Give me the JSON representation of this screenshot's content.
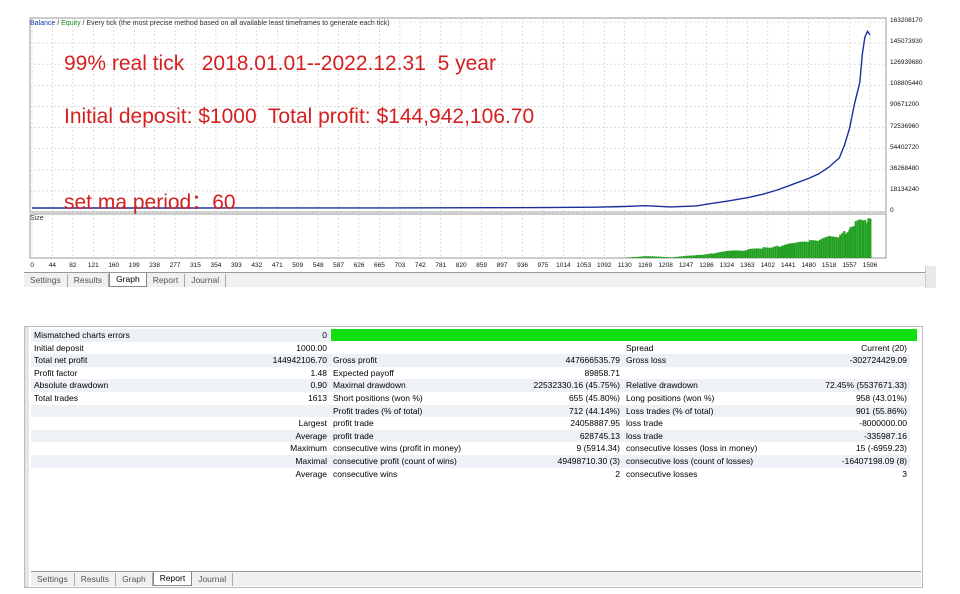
{
  "chart": {
    "legend": {
      "balance": "Balance",
      "separator1": " / ",
      "equity": "Equity",
      "rest": " / Every tick (the most precise method based on all available least timeframes to generate each tick)"
    },
    "overlay_lines": [
      "99% real tick   2018.01.01--2022.12.31  5 year",
      "Initial deposit: $1000  Total profit: $144,942,106.70",
      "set ma period：60"
    ],
    "size_label": "Size",
    "y_ticks": [
      "163208170",
      "145073930",
      "126939680",
      "108805440",
      "90671200",
      "72536960",
      "54402720",
      "36268480",
      "18134240",
      "0"
    ],
    "x_ticks": [
      "0",
      "44",
      "82",
      "121",
      "160",
      "199",
      "238",
      "277",
      "315",
      "354",
      "393",
      "432",
      "471",
      "509",
      "548",
      "587",
      "626",
      "665",
      "703",
      "742",
      "781",
      "820",
      "859",
      "897",
      "936",
      "975",
      "1014",
      "1053",
      "1092",
      "1130",
      "1169",
      "1208",
      "1247",
      "1286",
      "1324",
      "1363",
      "1402",
      "1441",
      "1480",
      "1518",
      "1557",
      "1596"
    ],
    "colors": {
      "balance": "#1a2f9a",
      "equity": "#2a9a2a",
      "grid": "#c8c8c8",
      "volume": "#22a022"
    }
  },
  "chart_data": {
    "type": "line",
    "x": [
      0,
      100,
      200,
      300,
      400,
      500,
      600,
      700,
      800,
      900,
      1000,
      1100,
      1150,
      1200,
      1250,
      1300,
      1330,
      1360,
      1400,
      1430,
      1460,
      1490,
      1520,
      1540,
      1560,
      1580,
      1590,
      1600,
      1610,
      1620,
      1625,
      1630,
      1635,
      1640
    ],
    "series": [
      {
        "name": "Balance",
        "values": [
          1000,
          2000,
          5000,
          9000,
          15000,
          25000,
          45000,
          90000,
          160000,
          250000,
          400000,
          700000,
          1200000,
          2000000,
          900000,
          1800000,
          4000000,
          6000000,
          9000000,
          12000000,
          16000000,
          21000000,
          26000000,
          30000000,
          36000000,
          44000000,
          55000000,
          70000000,
          92000000,
          110000000,
          135000000,
          150000000,
          155000000,
          152000000
        ]
      }
    ],
    "ylim": [
      0,
      163208170
    ],
    "xlim": [
      0,
      1640
    ],
    "volume_series": [
      0,
      0,
      0,
      0,
      0,
      0,
      0,
      0,
      0,
      0,
      0,
      0,
      0,
      0.05,
      0.02,
      0.08,
      0.12,
      0.18,
      0.22,
      0.28,
      0.32,
      0.38,
      0.45,
      0.5,
      0.55,
      0.62,
      0.7,
      0.8,
      0.92,
      1.0,
      0.95,
      1.0,
      1.0,
      0.98
    ]
  },
  "top_tabs": [
    "Settings",
    "Results",
    "Graph",
    "Report",
    "Journal"
  ],
  "top_active_tab": "Graph",
  "report": {
    "bar_label": "Mismatched charts errors",
    "bar_value": "0",
    "rows": [
      [
        "Initial deposit",
        "1000.00",
        "",
        "",
        "Spread",
        "Current (20)"
      ],
      [
        "Total net profit",
        "144942106.70",
        "Gross profit",
        "447666535.79",
        "Gross loss",
        "-302724429.09"
      ],
      [
        "Profit factor",
        "1.48",
        "Expected payoff",
        "89858.71",
        "",
        ""
      ],
      [
        "Absolute drawdown",
        "0.90",
        "Maximal drawdown",
        "22532330.16 (45.75%)",
        "Relative drawdown",
        "72.45% (5537671.33)"
      ],
      [
        "Total trades",
        "1613",
        "Short positions (won %)",
        "655 (45.80%)",
        "Long positions (won %)",
        "958 (43.01%)"
      ],
      [
        "",
        "",
        "Profit trades (% of total)",
        "712 (44.14%)",
        "Loss trades (% of total)",
        "901 (55.86%)"
      ],
      [
        "",
        "Largest",
        "profit trade",
        "24058887.95",
        "loss trade",
        "-8000000.00"
      ],
      [
        "",
        "Average",
        "profit trade",
        "628745.13",
        "loss trade",
        "-335987.16"
      ],
      [
        "",
        "Maximum",
        "consecutive wins (profit in money)",
        "9 (5914.34)",
        "consecutive losses (loss in money)",
        "15 (-6959.23)"
      ],
      [
        "",
        "Maximal",
        "consecutive profit (count of wins)",
        "49498710.30 (3)",
        "consecutive loss (count of losses)",
        "-16407198.09 (8)"
      ],
      [
        "",
        "Average",
        "consecutive wins",
        "2",
        "consecutive losses",
        "3"
      ]
    ],
    "bar_color": "#10e010"
  },
  "bottom_tabs": [
    "Settings",
    "Results",
    "Graph",
    "Report",
    "Journal"
  ],
  "bottom_active_tab": "Report"
}
